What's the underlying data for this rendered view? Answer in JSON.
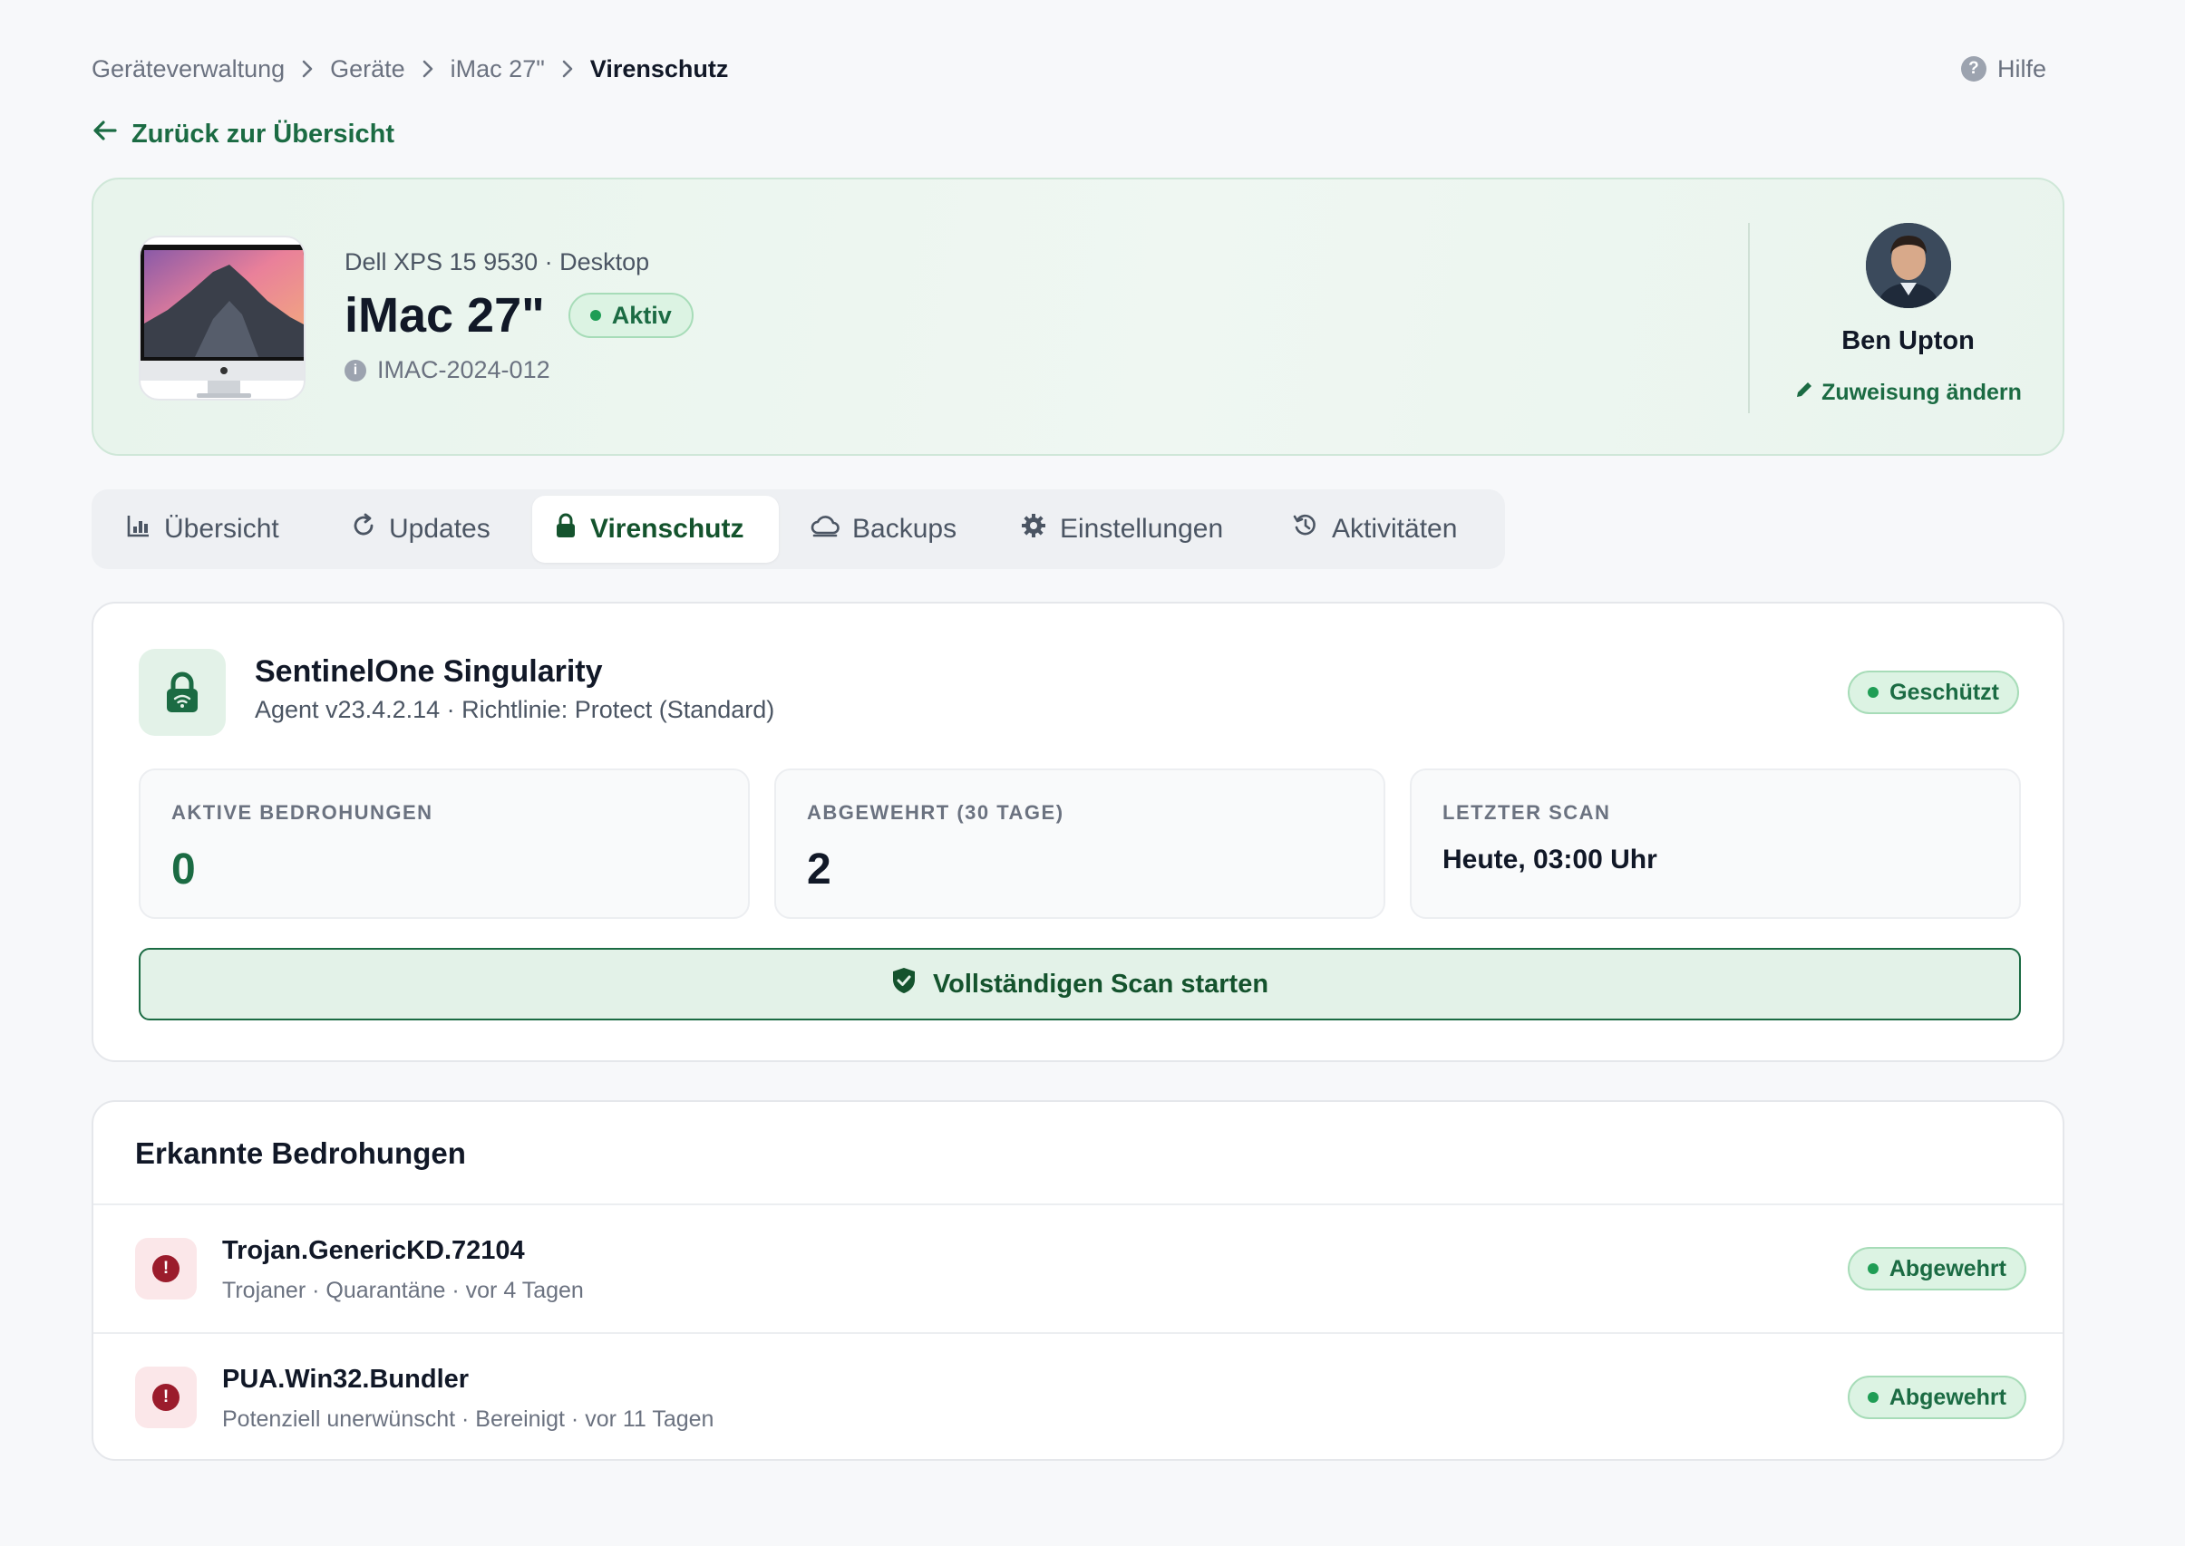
{
  "breadcrumb": {
    "items": [
      "Geräteverwaltung",
      "Geräte",
      "iMac 27\""
    ],
    "current": "Virenschutz"
  },
  "help_label": "Hilfe",
  "back_label": "Zurück zur Übersicht",
  "device": {
    "subtitle": "Dell XPS 15 9530 · Desktop",
    "title": "iMac 27\"",
    "status": "Aktiv",
    "asset_id": "IMAC-2024-012"
  },
  "assignee": {
    "name": "Ben Upton",
    "change_label": "Zuweisung ändern"
  },
  "tabs": [
    {
      "label": "Übersicht",
      "icon": "chart-icon",
      "active": false
    },
    {
      "label": "Updates",
      "icon": "refresh-icon",
      "active": false
    },
    {
      "label": "Virenschutz",
      "icon": "lock-icon",
      "active": true
    },
    {
      "label": "Backups",
      "icon": "cloud-icon",
      "active": false
    },
    {
      "label": "Einstellungen",
      "icon": "gear-icon",
      "active": false
    },
    {
      "label": "Aktivitäten",
      "icon": "history-icon",
      "active": false
    }
  ],
  "antivirus": {
    "product": "SentinelOne Singularity",
    "details": "Agent v23.4.2.14 · Richtlinie: Protect (Standard)",
    "status": "Geschützt",
    "stats": [
      {
        "label": "AKTIVE BEDROHUNGEN",
        "value": "0"
      },
      {
        "label": "ABGEWEHRT (30 TAGE)",
        "value": "2"
      },
      {
        "label": "LETZTER SCAN",
        "value": "Heute, 03:00 Uhr"
      }
    ],
    "scan_button": "Vollständigen Scan starten"
  },
  "threats": {
    "title": "Erkannte Bedrohungen",
    "items": [
      {
        "name": "Trojan.GenericKD.72104",
        "meta": "Trojaner · Quarantäne · vor 4 Tagen",
        "status": "Abgewehrt"
      },
      {
        "name": "PUA.Win32.Bundler",
        "meta": "Potenziell unerwünscht · Bereinigt · vor 11 Tagen",
        "status": "Abgewehrt"
      }
    ]
  },
  "colors": {
    "accent": "#1b6b43",
    "accent_bg": "#e3f2e8",
    "danger": "#9b1c2c",
    "page_bg": "#f7f8fa"
  }
}
